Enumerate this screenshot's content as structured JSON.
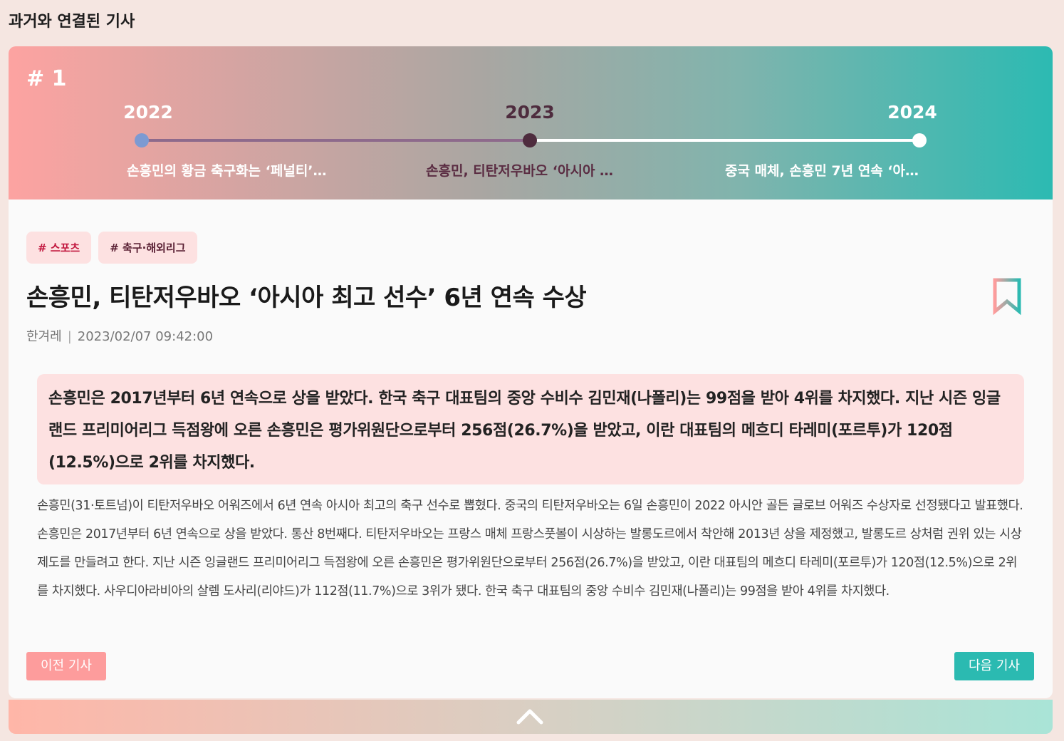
{
  "page": {
    "heading": "과거와 연결된 기사"
  },
  "timeline": {
    "rank": "# 1",
    "items": [
      {
        "year": "2022",
        "title": "손흥민의 황금 축구화는 ‘페널티’…"
      },
      {
        "year": "2023",
        "title": "손흥민, 티탄저우바오 ‘아시아 …"
      },
      {
        "year": "2024",
        "title": "중국 매체, 손흥민 7년 연속 ‘아…"
      }
    ],
    "active_index": 1,
    "colors": {
      "past_dot": "#7c9ad2",
      "active_dot": "#4e2c3e",
      "future_dot": "#ffffff",
      "past_track": "#8e6a8c",
      "future_track": "#ffffff"
    }
  },
  "article": {
    "tags": [
      "# 스포츠",
      "# 축구·해외리그"
    ],
    "title": "손흥민, 티탄저우바오 ‘아시아 최고 선수’ 6년 연속 수상",
    "source": "한겨레",
    "separator": "|",
    "datetime": "2023/02/07 09:42:00",
    "summary": "손흥민은 2017년부터 6년 연속으로 상을 받았다. 한국 축구 대표팀의 중앙 수비수 김민재(나폴리)는 99점을 받아 4위를 차지했다. 지난 시즌 잉글랜드 프리미어리그 득점왕에 오른 손흥민은 평가위원단으로부터 256점(26.7%)을 받았고, 이란 대표팀의 메흐디 타레미(포르투)가 120점(12.5%)으로 2위를 차지했다.",
    "body": "손흥민(31·토트넘)이 티탄저우바오 어워즈에서 6년 연속 아시아 최고의 축구 선수로 뽑혔다. 중국의 티탄저우바오는 6일 손흥민이 2022 아시안 골든 글로브 어워즈 수상자로 선정됐다고 발표했다. 손흥민은 2017년부터 6년 연속으로 상을 받았다. 통산 8번째다. 티탄저우바오는 프랑스 매체 프랑스풋볼이 시상하는 발롱도르에서 착안해 2013년 상을 제정했고, 발롱도르 상처럼 권위 있는 시상제도를 만들려고 한다. 지난 시즌 잉글랜드 프리미어리그 득점왕에 오른 손흥민은 평가위원단으로부터 256점(26.7%)을 받았고, 이란 대표팀의 메흐디 타레미(포르투)가 120점(12.5%)으로 2위를 차지했다. 사우디아라비아의 살렘 도사리(리야드)가 112점(11.7%)으로 3위가 됐다. 한국 축구 대표팀의 중앙 수비수 김민재(나폴리)는 99점을 받아 4위를 차지했다.",
    "bookmark_icon": "bookmark-icon"
  },
  "buttons": {
    "prev_label": "이전 기사",
    "next_label": "다음 기사",
    "collapse_icon": "chevron-up-icon"
  },
  "colors": {
    "accent_pink": "#fd9c9c",
    "accent_teal": "#2bbab1",
    "tag_bg": "#fde1e1",
    "tag_text": "#c2183f"
  }
}
